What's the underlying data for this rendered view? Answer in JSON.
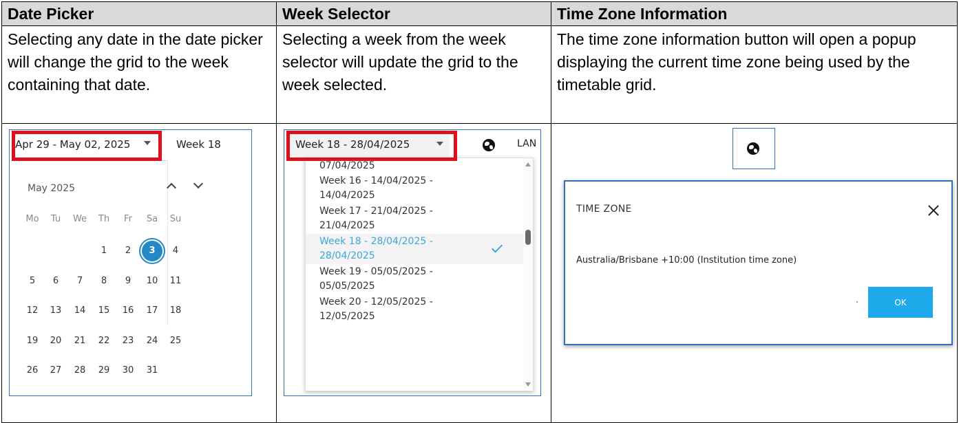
{
  "columns": [
    {
      "header": "Date Picker",
      "description": "Selecting any date in the date picker will change the grid to the week containing that date."
    },
    {
      "header": "Week Selector",
      "description": "Selecting a week from the week selector will update the grid to the week selected."
    },
    {
      "header": "Time Zone Information",
      "description": "The time zone information button will open a popup displaying the current time zone being used by the timetable grid."
    }
  ],
  "date_picker": {
    "range_label": "Apr 29 - May 02, 2025",
    "week_label": "Week 18",
    "month_label": "May 2025",
    "weekdays": [
      "Mo",
      "Tu",
      "We",
      "Th",
      "Fr",
      "Sa",
      "Su"
    ],
    "selected_day": "3",
    "weeks": [
      [
        "",
        "",
        "",
        "1",
        "2",
        "3",
        "4"
      ],
      [
        "5",
        "6",
        "7",
        "8",
        "9",
        "10",
        "11"
      ],
      [
        "12",
        "13",
        "14",
        "15",
        "16",
        "17",
        "18"
      ],
      [
        "19",
        "20",
        "21",
        "22",
        "23",
        "24",
        "25"
      ],
      [
        "26",
        "27",
        "28",
        "29",
        "30",
        "31",
        ""
      ]
    ]
  },
  "week_selector": {
    "button_label": "Week 18 - 28/04/2025",
    "next_label": "LAN",
    "items": [
      {
        "line1": "07/04/2025",
        "line2": ""
      },
      {
        "line1": "Week 16 - 14/04/2025 -",
        "line2": "14/04/2025"
      },
      {
        "line1": "Week 17 - 21/04/2025 -",
        "line2": "21/04/2025"
      },
      {
        "line1": "Week 18 - 28/04/2025 -",
        "line2": "28/04/2025"
      },
      {
        "line1": "Week 19 - 05/05/2025 -",
        "line2": "05/05/2025"
      },
      {
        "line1": "Week 20 - 12/05/2025 -",
        "line2": "12/05/2025"
      }
    ],
    "selected_index": 3
  },
  "time_zone": {
    "dialog_title": "TIME ZONE",
    "zone_text": "Australia/Brisbane +10:00 (Institution time zone)",
    "ok_label": "OK"
  },
  "colors": {
    "accent_blue": "#2389c4",
    "highlight_text": "#3ba8db",
    "ok_button": "#1eaaea",
    "callout_red": "#e00f1c",
    "frame_blue": "#2f6fc2"
  }
}
